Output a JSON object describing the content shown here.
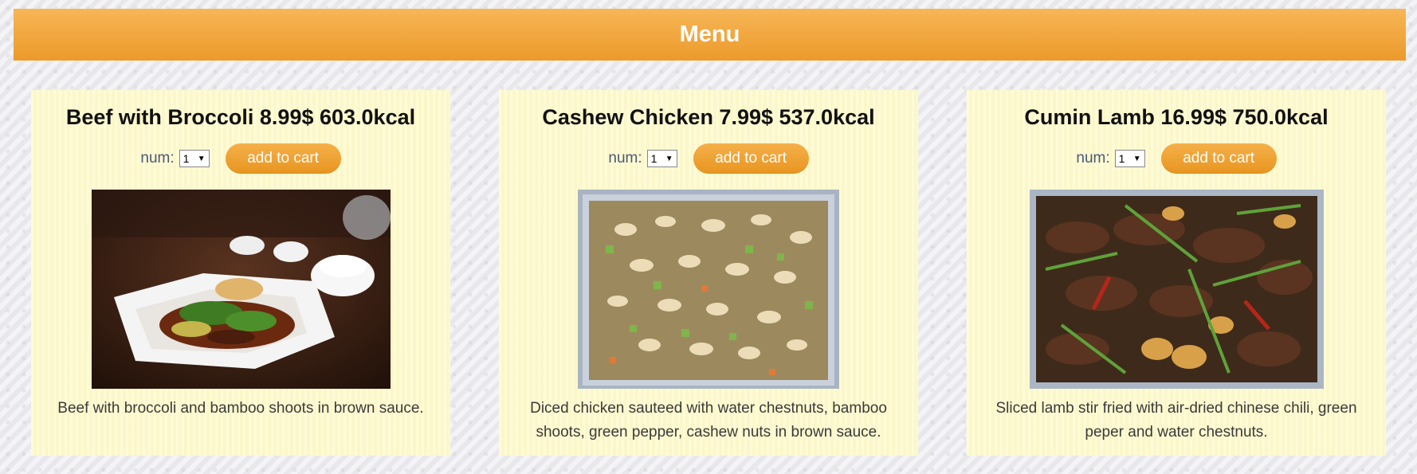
{
  "header": {
    "title": "Menu"
  },
  "items": [
    {
      "title": "Beef with Broccoli 8.99$ 603.0kcal",
      "num_label": "num:",
      "num_value": "1",
      "button_label": "add to cart",
      "image_alt": "beef-with-broccoli-photo",
      "description": "Beef with broccoli and bamboo shoots in brown sauce."
    },
    {
      "title": "Cashew Chicken 7.99$ 537.0kcal",
      "num_label": "num:",
      "num_value": "1",
      "button_label": "add to cart",
      "image_alt": "cashew-chicken-photo",
      "description": "Diced chicken sauteed with water chestnuts, bamboo shoots, green pepper, cashew nuts in brown sauce."
    },
    {
      "title": "Cumin Lamb 16.99$ 750.0kcal",
      "num_label": "num:",
      "num_value": "1",
      "button_label": "add to cart",
      "image_alt": "cumin-lamb-photo",
      "description": "Sliced lamb stir fried with air-dried chinese chili, green peper and water chestnuts."
    }
  ]
}
